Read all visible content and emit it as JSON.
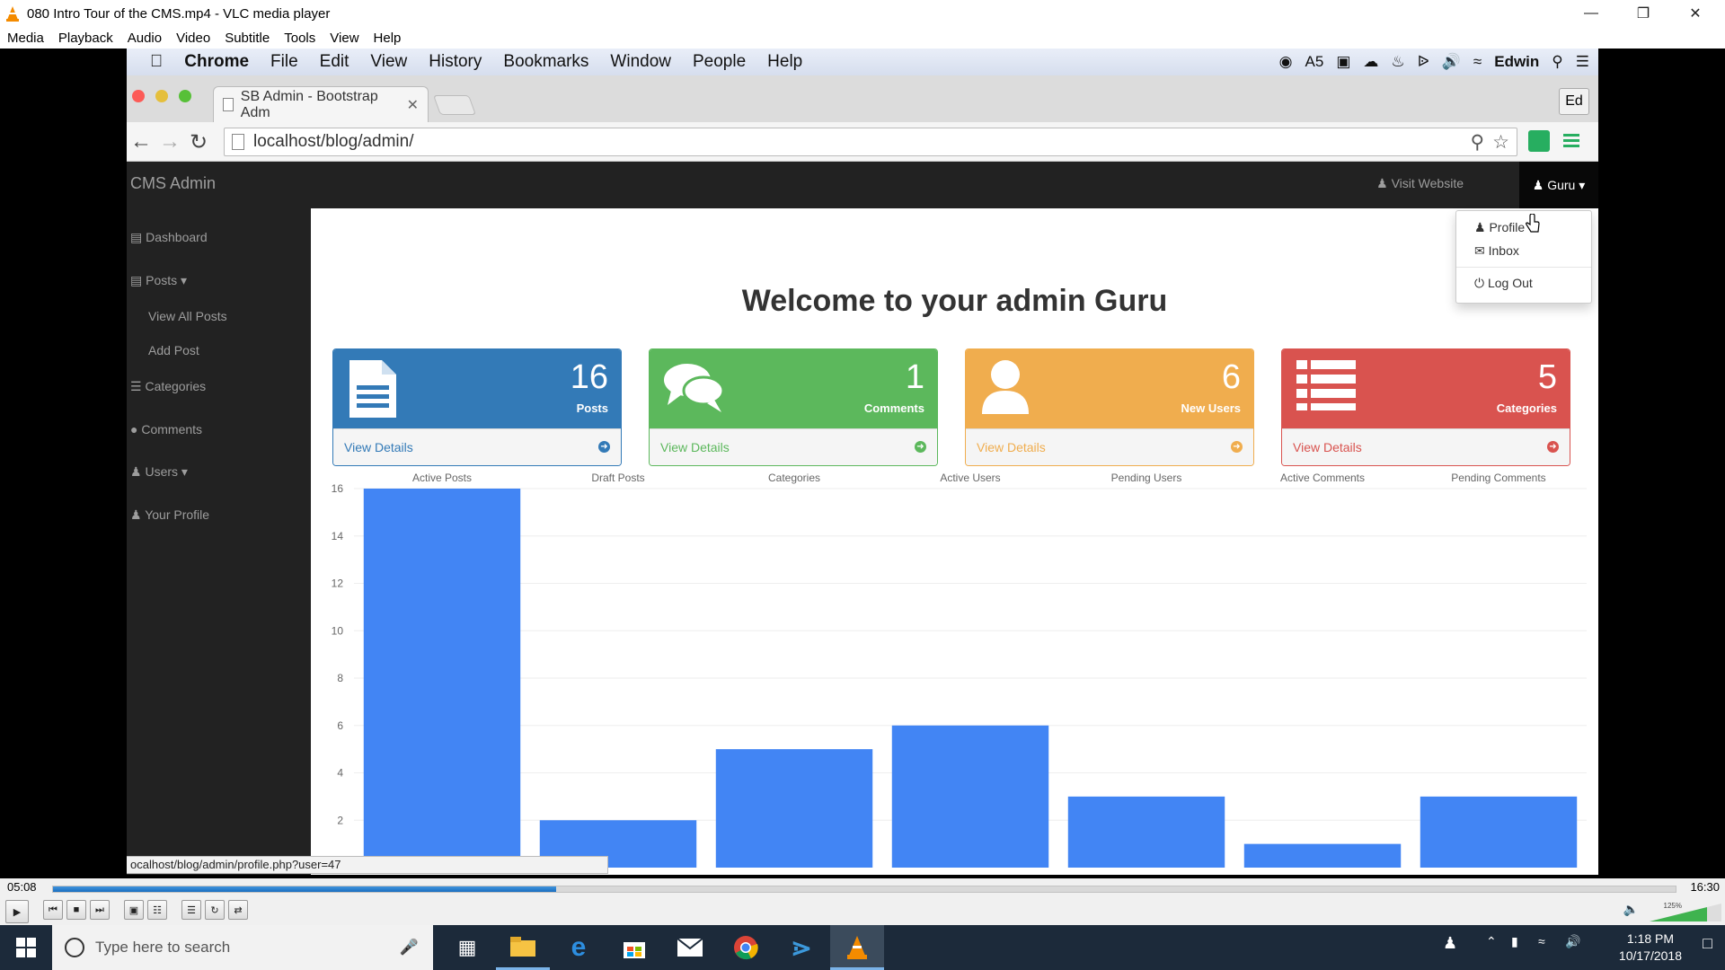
{
  "vlc": {
    "title": "080 Intro Tour of the CMS.mp4 - VLC media player",
    "menu": [
      "Media",
      "Playback",
      "Audio",
      "Video",
      "Subtitle",
      "Tools",
      "View",
      "Help"
    ],
    "time_elapsed": "05:08",
    "time_total": "16:30",
    "progress_fraction": 0.31,
    "volume_label": "125%"
  },
  "mac_menubar": {
    "app": "Chrome",
    "items": [
      "File",
      "Edit",
      "View",
      "History",
      "Bookmarks",
      "Window",
      "People",
      "Help"
    ],
    "user": "Edwin",
    "badge": "5"
  },
  "chrome": {
    "tab_title": "SB Admin - Bootstrap Adm",
    "url": "localhost/blog/admin/",
    "profile": "Ed",
    "status_url": "ocalhost/blog/admin/profile.php?user=47"
  },
  "cms": {
    "brand": "CMS Admin",
    "visit_website": "Visit Website",
    "user_menu": "Guru",
    "dropdown": [
      "Profile",
      "Inbox",
      "Log Out"
    ],
    "sidebar": {
      "dashboard": "Dashboard",
      "posts": "Posts",
      "view_all_posts": "View All Posts",
      "add_post": "Add Post",
      "categories": "Categories",
      "comments": "Comments",
      "users": "Users",
      "your_profile": "Your Profile"
    },
    "welcome": "Welcome to your admin Guru",
    "panels": [
      {
        "count": "16",
        "label": "Posts",
        "link": "View Details",
        "color": "#337ab7"
      },
      {
        "count": "1",
        "label": "Comments",
        "link": "View Details",
        "color": "#5cb85c"
      },
      {
        "count": "6",
        "label": "New Users",
        "link": "View Details",
        "color": "#f0ad4e"
      },
      {
        "count": "5",
        "label": "Categories",
        "link": "View Details",
        "color": "#d9534f"
      }
    ]
  },
  "chart_data": {
    "type": "bar",
    "categories": [
      "Active Posts",
      "Draft Posts",
      "Categories",
      "Active Users",
      "Pending Users",
      "Active Comments",
      "Pending Comments"
    ],
    "values": [
      16,
      2,
      5,
      6,
      3,
      1,
      3
    ],
    "yticks": [
      "2",
      "4",
      "6",
      "8",
      "10",
      "12",
      "14",
      "16"
    ],
    "ylim": [
      0,
      16
    ],
    "color": "#4285f4",
    "legend": "top"
  },
  "taskbar": {
    "search_placeholder": "Type here to search",
    "time": "1:18 PM",
    "date": "10/17/2018"
  }
}
